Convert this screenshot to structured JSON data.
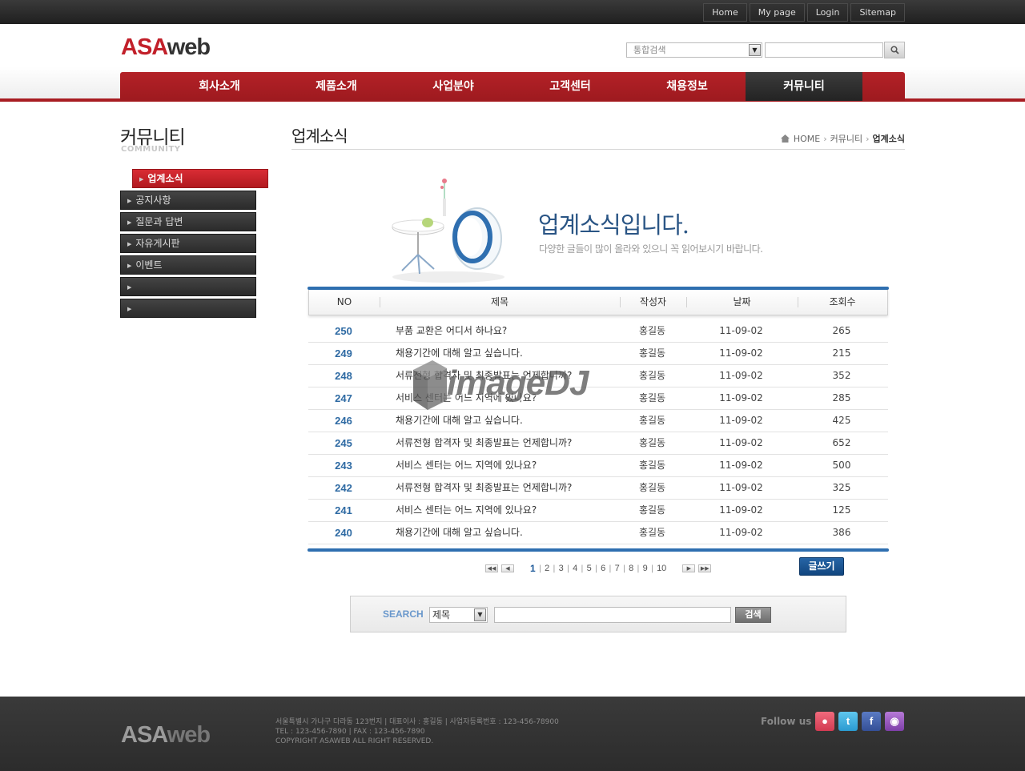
{
  "utility_links": [
    "Home",
    "My page",
    "Login",
    "Sitemap"
  ],
  "logo": {
    "part1": "ASA",
    "part2": "web"
  },
  "top_search": {
    "select_value": "통합검색",
    "input_value": ""
  },
  "gnb": [
    "회사소개",
    "제품소개",
    "사업분야",
    "고객센터",
    "채용정보",
    "커뮤니티"
  ],
  "gnb_active": 5,
  "sidebar": {
    "title": "커뮤니티",
    "subtitle": "COMMUNITY",
    "items": [
      "업계소식",
      "공지사항",
      "질문과 답변",
      "자유게시판",
      "이벤트",
      "",
      ""
    ],
    "active": 0
  },
  "content": {
    "title": "업계소식",
    "breadcrumb": [
      "HOME",
      "커뮤니티",
      "업계소식"
    ],
    "visual_title": "업계소식입니다.",
    "visual_sub": "다양한 글들이 많이 올라와 있으니 꼭 읽어보시기 바랍니다."
  },
  "table": {
    "headers": [
      "NO",
      "제목",
      "작성자",
      "날짜",
      "조회수"
    ],
    "rows": [
      [
        "250",
        "부품 교환은 어디서 하나요?",
        "홍길동",
        "11-09-02",
        "265"
      ],
      [
        "249",
        "채용기간에 대해 알고 싶습니다.",
        "홍길동",
        "11-09-02",
        "215"
      ],
      [
        "248",
        "서류전형 합격자 및 최종발표는 언제합니까?",
        "홍길동",
        "11-09-02",
        "352"
      ],
      [
        "247",
        "서비스 센터는 어느 지역에 있나요?",
        "홍길동",
        "11-09-02",
        "285"
      ],
      [
        "246",
        "채용기간에 대해 알고 싶습니다.",
        "홍길동",
        "11-09-02",
        "425"
      ],
      [
        "245",
        "서류전형 합격자 및 최종발표는 언제합니까?",
        "홍길동",
        "11-09-02",
        "652"
      ],
      [
        "243",
        "서비스 센터는 어느 지역에 있나요?",
        "홍길동",
        "11-09-02",
        "500"
      ],
      [
        "242",
        "서류전형 합격자 및 최종발표는 언제합니까?",
        "홍길동",
        "11-09-02",
        "325"
      ],
      [
        "241",
        "서비스 센터는 어느 지역에 있나요?",
        "홍길동",
        "11-09-02",
        "125"
      ],
      [
        "240",
        "채용기간에 대해 알고 싶습니다.",
        "홍길동",
        "11-09-02",
        "386"
      ]
    ]
  },
  "pagination": {
    "pages": [
      "1",
      "2",
      "3",
      "4",
      "5",
      "6",
      "7",
      "8",
      "9",
      "10"
    ],
    "current": "1"
  },
  "write_label": "글쓰기",
  "bottom_search": {
    "label": "SEARCH",
    "select_value": "제목",
    "input_value": "",
    "button": "검색"
  },
  "watermark": "imageDJ",
  "footer": {
    "logo1": "ASA",
    "logo2": "web",
    "line1": "서울특별시 가나구 다라동 123번지  |  대표이사 : 홍길동  |  사업자등록번호 : 123-456-78900",
    "line2": "TEL : 123-456-7890  |  FAX : 123-456-7890",
    "line3": "COPYRIGHT ASAWEB ALL RIGHT RESERVED.",
    "follow": "Follow us :"
  },
  "colors": {
    "brand_red": "#b32127",
    "accent_blue": "#2f6fb0",
    "dark": "#2b2b2b"
  }
}
